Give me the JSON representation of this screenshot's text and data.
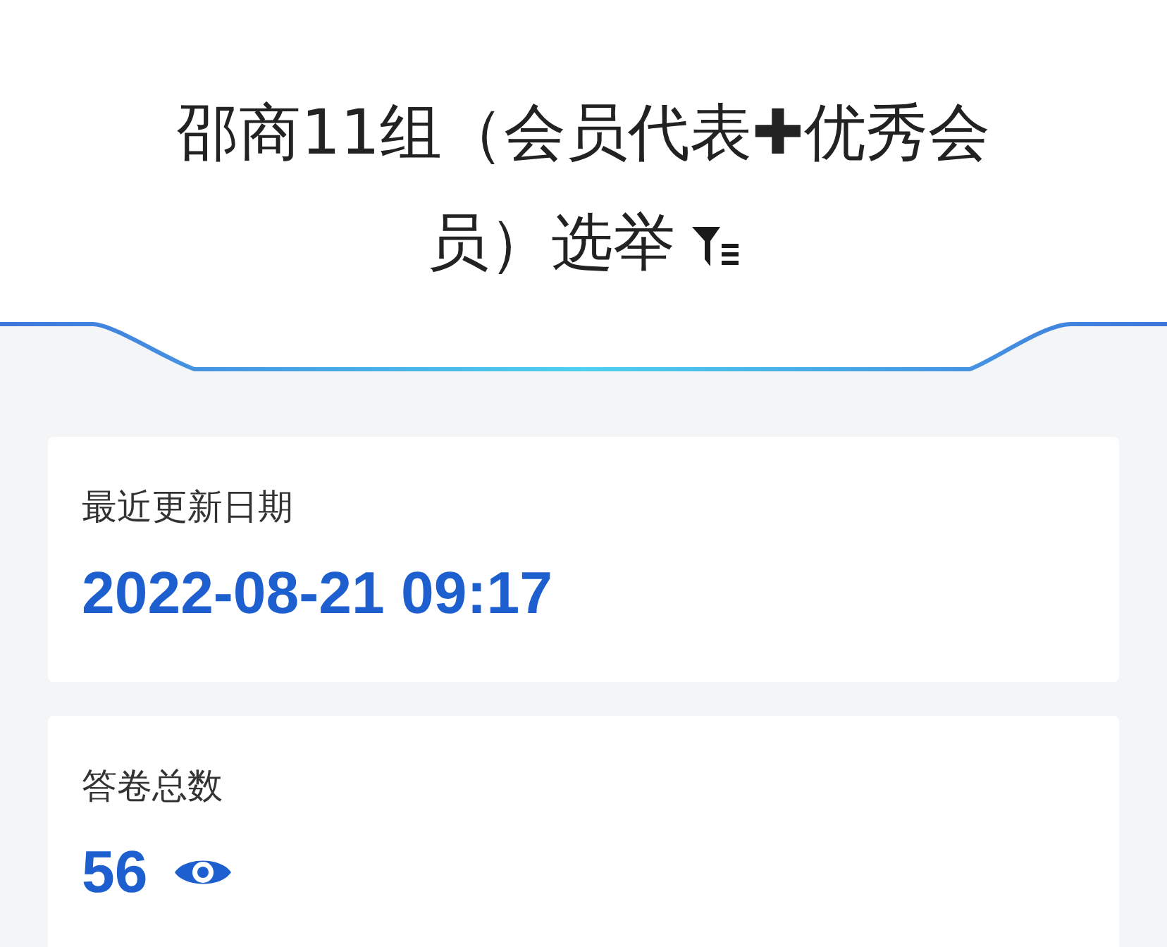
{
  "title_lines": [
    "邵商11组（会员代表✚优秀会",
    "员）选举"
  ],
  "stats": [
    {
      "label": "最近更新日期",
      "value": "2022-08-21 09:17",
      "kind": "date"
    },
    {
      "label": "答卷总数",
      "value": "56",
      "kind": "count"
    }
  ]
}
